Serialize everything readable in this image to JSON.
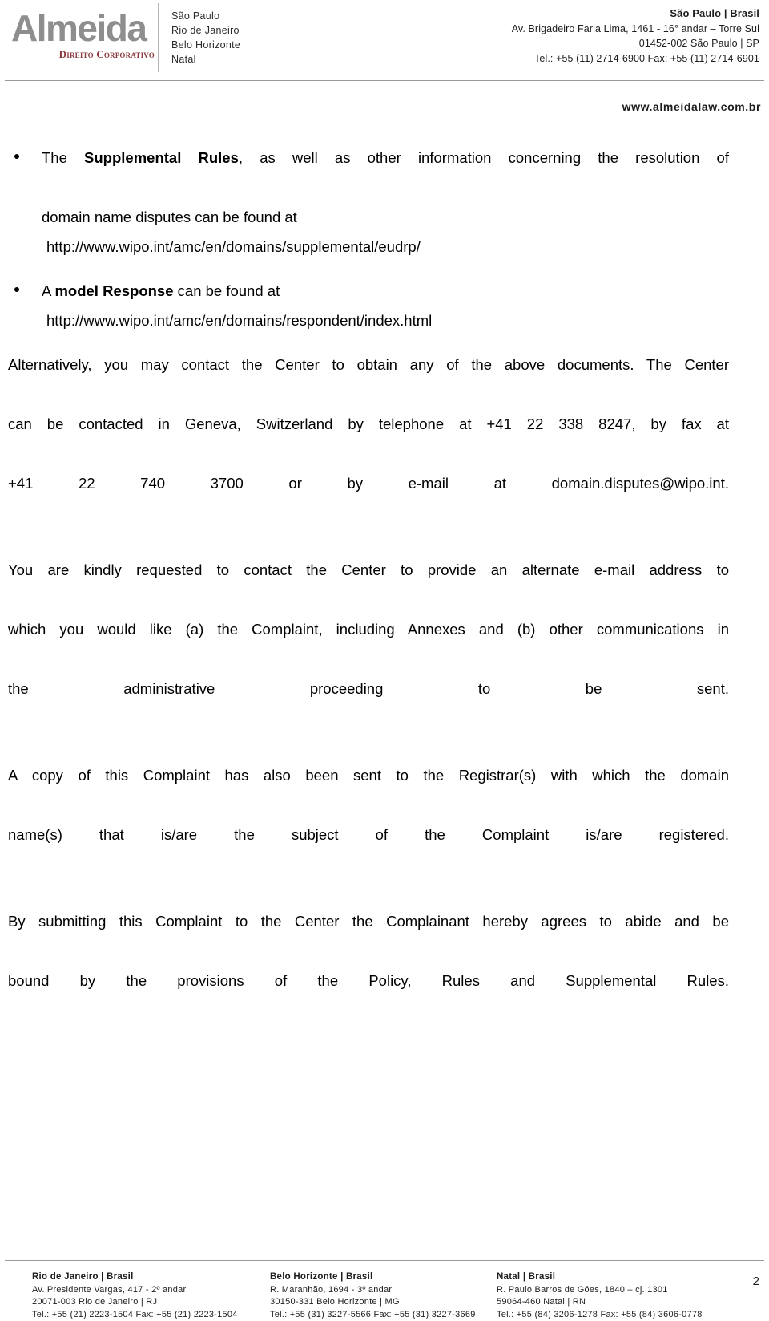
{
  "header": {
    "logo": {
      "wordmark": "Almeida",
      "tagline": "Direito Corporativo",
      "wordmark_color": "#8e8e8e",
      "tagline_color": "#8a3a3f"
    },
    "offices": [
      "São Paulo",
      "Rio de Janeiro",
      "Belo Horizonte",
      "Natal"
    ],
    "headquarters": {
      "city_line": "São Paulo |  Brasil",
      "address_line": "Av. Brigadeiro Faria Lima, 1461 - 16° andar – Torre Sul",
      "postal_line": "01452-002  São Paulo |  SP",
      "contact_line": "Tel.: +55 (11) 2714-6900  Fax: +55 (11) 2714-6901"
    }
  },
  "website": "www.almeidalaw.com.br",
  "body": {
    "bullets": [
      {
        "lead_prefix": "The ",
        "lead_bold": "Supplemental Rules",
        "lead_suffix": ", as well as other information concerning the resolution of",
        "second_line": "domain name disputes can be found at",
        "url": "http://www.wipo.int/amc/en/domains/supplemental/eudrp/"
      },
      {
        "lead_prefix": "A ",
        "lead_bold": "model Response",
        "lead_suffix": " can be found at",
        "second_line": "",
        "url": "http://www.wipo.int/amc/en/domains/respondent/index.html"
      }
    ],
    "paragraphs": [
      {
        "lines": [
          "Alternatively, you may contact the Center to obtain any of the above documents.  The Center",
          "can be contacted in Geneva, Switzerland by telephone at +41 22 338 8247, by fax at"
        ],
        "tail": "+41 22 740 3700 or by e-mail at domain.disputes@wipo.int."
      },
      {
        "lines": [
          "You are kindly requested to contact the Center to provide an alternate e-mail address to",
          "which you would like (a) the Complaint, including Annexes and (b) other communications in"
        ],
        "tail": "the administrative proceeding to be sent."
      },
      {
        "lines": [
          "A copy of this Complaint has also been sent to the Registrar(s) with which the domain"
        ],
        "tail": "name(s) that is/are the subject of the Complaint is/are registered."
      },
      {
        "lines": [
          "By submitting this Complaint to the Center the Complainant hereby agrees to abide and be",
          "bound by the provisions of the Policy, Rules and Supplemental Rules."
        ],
        "tail": ""
      }
    ]
  },
  "footer": {
    "offices": [
      {
        "city": "Rio de Janeiro |  Brasil",
        "street": "Av. Presidente Vargas, 417 - 2º andar",
        "postal": "20071-003  Rio de Janeiro |  RJ",
        "contact": "Tel.: +55 (21) 2223-1504   Fax: +55 (21) 2223-1504"
      },
      {
        "city": "Belo Horizonte |  Brasil",
        "street": "R. Maranhão, 1694 - 3º andar",
        "postal": "30150-331  Belo Horizonte |  MG",
        "contact": "Tel.: +55 (31) 3227-5566   Fax: +55 (31) 3227-3669"
      },
      {
        "city": "Natal |  Brasil",
        "street": "R. Paulo Barros de Góes, 1840 – cj. 1301",
        "postal": "59064-460  Natal |  RN",
        "contact": "Tel.: +55 (84) 3206-1278  Fax: +55 (84) 3606-0778"
      }
    ],
    "page_number": "2"
  }
}
